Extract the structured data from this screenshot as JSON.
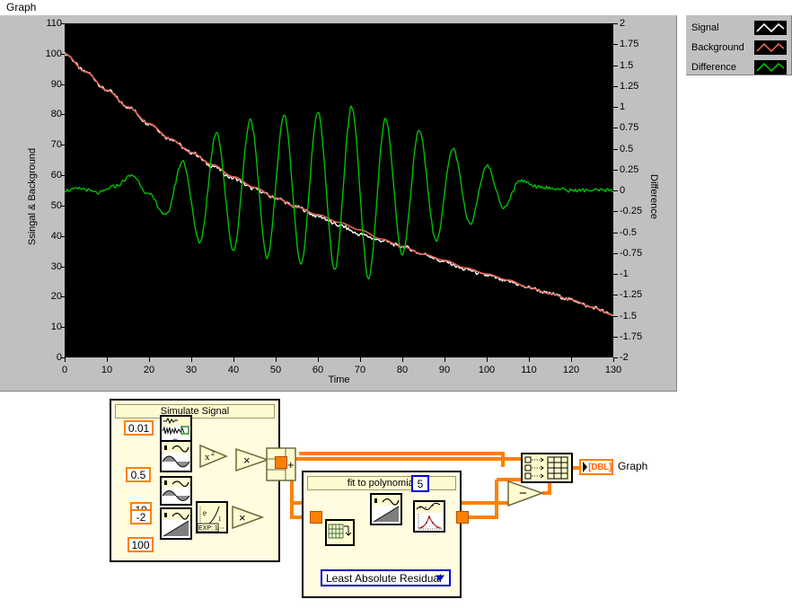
{
  "panel": {
    "graph_title": "Graph"
  },
  "chart_data": {
    "type": "line",
    "title": "Graph",
    "xlabel": "Time",
    "ylabel": "Ssingal & Background",
    "y2label": "Difference",
    "xlim": [
      0,
      130
    ],
    "ylim": [
      0,
      110
    ],
    "y2lim": [
      -2,
      2
    ],
    "grid": false,
    "legend_position": "top-right",
    "background": "#000000",
    "x_ticks": [
      0,
      10,
      20,
      30,
      40,
      50,
      60,
      70,
      80,
      90,
      100,
      110,
      120,
      130
    ],
    "y_ticks": [
      0,
      10,
      20,
      30,
      40,
      50,
      60,
      70,
      80,
      90,
      100,
      110
    ],
    "y2_ticks": [
      2,
      1.75,
      1.5,
      1.25,
      1,
      0.75,
      0.5,
      0.25,
      0,
      -0.25,
      -0.5,
      -0.75,
      -1,
      -1.25,
      -1.5,
      -1.75,
      -2
    ],
    "series": [
      {
        "name": "Signal",
        "color": "#ffffff",
        "axis": "left",
        "description": "Noisy exponentially decaying signal from 100 at t=0 to ~14 at t=130",
        "x": [
          0,
          5,
          10,
          15,
          20,
          25,
          30,
          35,
          40,
          45,
          50,
          55,
          60,
          65,
          70,
          75,
          80,
          85,
          90,
          95,
          100,
          105,
          110,
          115,
          120,
          125,
          130
        ],
        "values": [
          100,
          94,
          88,
          82.5,
          77,
          72,
          67.5,
          63,
          59,
          55.5,
          52.5,
          49.5,
          46.5,
          43.5,
          40.5,
          38.5,
          36.5,
          34,
          31.5,
          29,
          27,
          25,
          23,
          21,
          19,
          16.5,
          14
        ]
      },
      {
        "name": "Background",
        "color": "#e86050",
        "axis": "left",
        "description": "5th-order polynomial least-absolute-residual fit to the signal",
        "x": [
          0,
          5,
          10,
          15,
          20,
          25,
          30,
          35,
          40,
          45,
          50,
          55,
          60,
          65,
          70,
          75,
          80,
          85,
          90,
          95,
          100,
          105,
          110,
          115,
          120,
          125,
          130
        ],
        "values": [
          100,
          94,
          88,
          82.5,
          77,
          72,
          67.5,
          63.5,
          59.5,
          56,
          52.5,
          49.5,
          47,
          44.5,
          42,
          39,
          36.5,
          34,
          32,
          29.5,
          27.5,
          25.5,
          23,
          21,
          19,
          16.5,
          14
        ]
      },
      {
        "name": "Difference",
        "color": "#00c000",
        "axis": "right",
        "description": "Signal minus background: noise plus a growing-then-decaying sinusoidal beat, amplitude peaking near t=68",
        "x": [
          0,
          4,
          8,
          12,
          16,
          20,
          24,
          28,
          32,
          36,
          40,
          44,
          48,
          52,
          56,
          60,
          64,
          68,
          72,
          76,
          80,
          84,
          88,
          92,
          96,
          100,
          104,
          108,
          112,
          116,
          120,
          124,
          130
        ],
        "values": [
          0.0,
          0.02,
          -0.03,
          0.05,
          0.18,
          -0.05,
          -0.3,
          0.35,
          -0.62,
          0.7,
          -0.72,
          0.85,
          -0.8,
          0.9,
          -0.88,
          0.95,
          -0.95,
          1.0,
          -1.05,
          0.85,
          -0.78,
          0.72,
          -0.6,
          0.5,
          -0.4,
          0.3,
          -0.2,
          0.12,
          0.05,
          0.02,
          0.0,
          0.0,
          0.0
        ]
      }
    ]
  },
  "legend": {
    "items": [
      {
        "label": "Signal",
        "color": "#ffffff"
      },
      {
        "label": "Background",
        "color": "#e86050"
      },
      {
        "label": "Difference",
        "color": "#00c000"
      }
    ]
  },
  "block_diagram": {
    "simulate_signal": {
      "title": "Simulate Signal",
      "constants": {
        "noise_amplitude": "0.01",
        "sine_amplitude": "0.5",
        "frequency": "10",
        "decay_rate": "-2",
        "offset": "100"
      },
      "nodes": {
        "square": "x²",
        "multiply_1": "×",
        "multiply_2": "×",
        "add": "+",
        "exponential": "EXP: 1",
        "exponential_base": "e"
      }
    },
    "fit_to_polynomial": {
      "title": "fit to polynomial",
      "polynomial_order": "5",
      "fit_method": "Least Absolute Residual"
    },
    "output": {
      "subtract_symbol": "−",
      "terminal_label": "[DBL]",
      "terminal_name": "Graph"
    }
  },
  "colors": {
    "panel_gray": "#c0c0c0",
    "plot_background": "#000000",
    "wire_orange": "#ff8000",
    "wire_blue": "#0000d0",
    "node_yellow": "#fffbd0",
    "signal": "#ffffff",
    "background_fit": "#e86050",
    "difference": "#00c000"
  }
}
